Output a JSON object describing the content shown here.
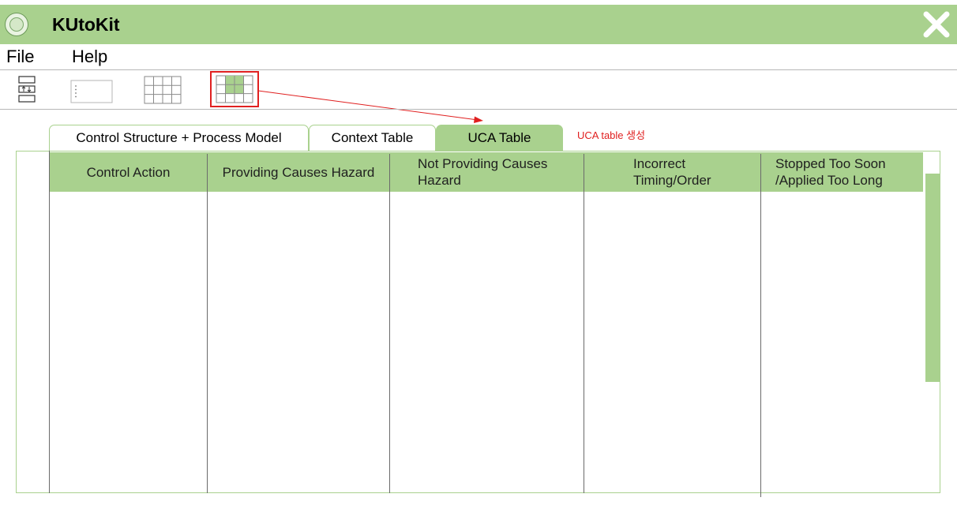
{
  "window": {
    "title": "KUtoKit",
    "close_icon": "close-x-icon",
    "logo_icon": "university-seal-icon"
  },
  "menu": {
    "items": [
      "File",
      "Help"
    ]
  },
  "toolbar": {
    "tools": [
      {
        "icon": "control-structure-icon"
      },
      {
        "icon": "abcd-list-icon"
      },
      {
        "icon": "context-table-grid-icon"
      },
      {
        "icon": "uca-table-grid-icon",
        "highlighted": true
      }
    ]
  },
  "tabs": [
    {
      "label": "Control Structure + Process Model",
      "active": false
    },
    {
      "label": "Context Table",
      "active": false
    },
    {
      "label": "UCA Table",
      "active": true
    }
  ],
  "annotation": {
    "text": "UCA table 생성",
    "color": "#e02020"
  },
  "uca_table": {
    "columns": [
      "Control Action",
      "Providing Causes Hazard",
      "Not Providing Causes Hazard",
      "Incorrect Timing/Order",
      "Stopped Too Soon /Applied Too Long"
    ],
    "rows": []
  },
  "colors": {
    "accent": "#a9d18e",
    "annotation": "#e02020",
    "grid_line": "#6b6b6b"
  }
}
